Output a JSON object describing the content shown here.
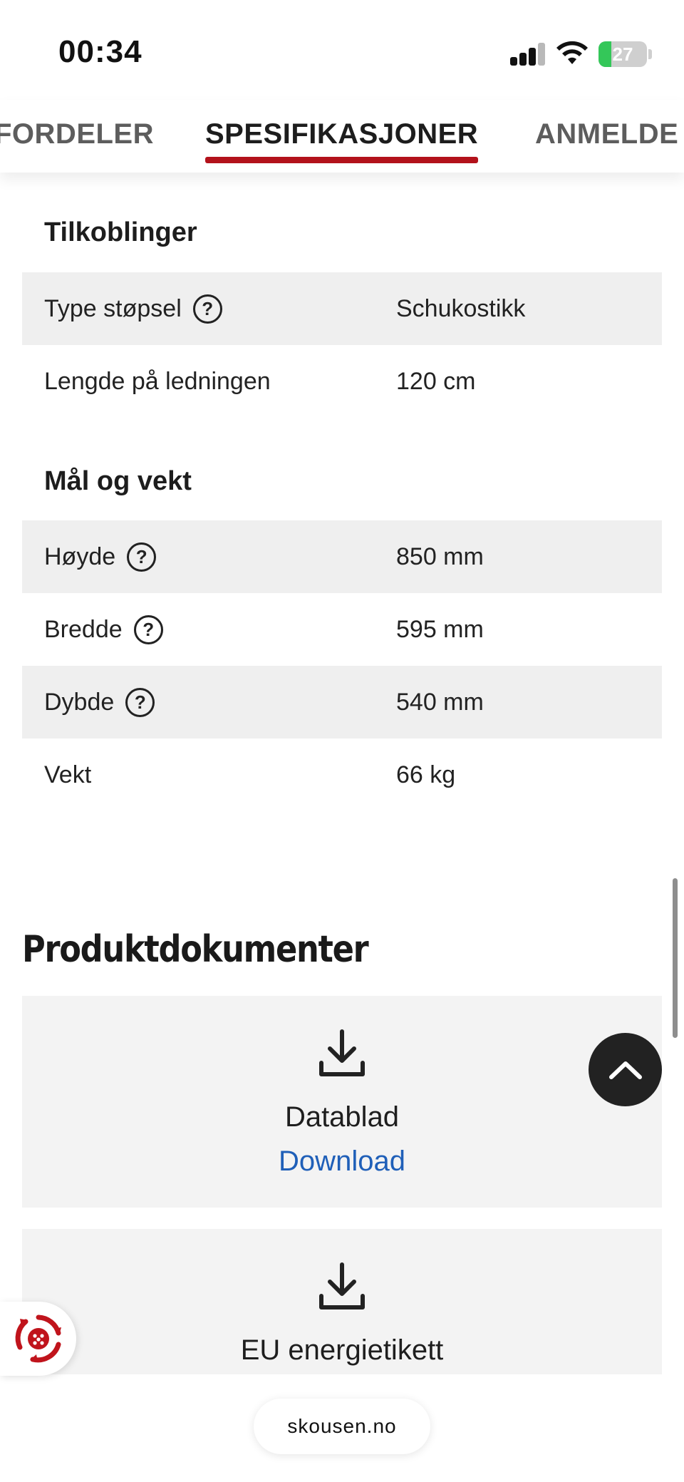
{
  "status_bar": {
    "time": "00:34",
    "battery_percent": "27",
    "battery_level": 0.27,
    "icons": [
      "signal-icon",
      "wifi-icon",
      "battery-icon"
    ]
  },
  "tabs": [
    {
      "label": "FORDELER",
      "active": false
    },
    {
      "label": "SPESIFIKASJONER",
      "active": true
    },
    {
      "label": "ANMELDE",
      "active": false
    }
  ],
  "colors": {
    "accent": "#b3121b",
    "link": "#1f5fb8",
    "row_shade": "#efefef",
    "card_bg": "#f3f3f3"
  },
  "sections": [
    {
      "title": "Tilkoblinger",
      "rows": [
        {
          "label": "Type støpsel",
          "help": "?",
          "value": "Schukostikk"
        },
        {
          "label": "Lengde på ledningen",
          "value": "120 cm"
        }
      ]
    },
    {
      "title": "Mål og vekt",
      "rows": [
        {
          "label": "Høyde",
          "help": "?",
          "value": "850 mm"
        },
        {
          "label": "Bredde",
          "help": "?",
          "value": "595 mm"
        },
        {
          "label": "Dybde",
          "help": "?",
          "value": "540 mm"
        },
        {
          "label": "Vekt",
          "value": "66 kg"
        }
      ]
    }
  ],
  "documents": {
    "title": "Produktdokumenter",
    "items": [
      {
        "name": "Datablad",
        "link": "Download",
        "icon": "download-icon"
      },
      {
        "name": "EU energietikett",
        "icon": "download-icon"
      }
    ]
  },
  "floating": {
    "back_to_top_icon": "chevron-up-icon",
    "chat_icon": "chat-widget-icon"
  },
  "browser": {
    "url": "skousen.no"
  }
}
